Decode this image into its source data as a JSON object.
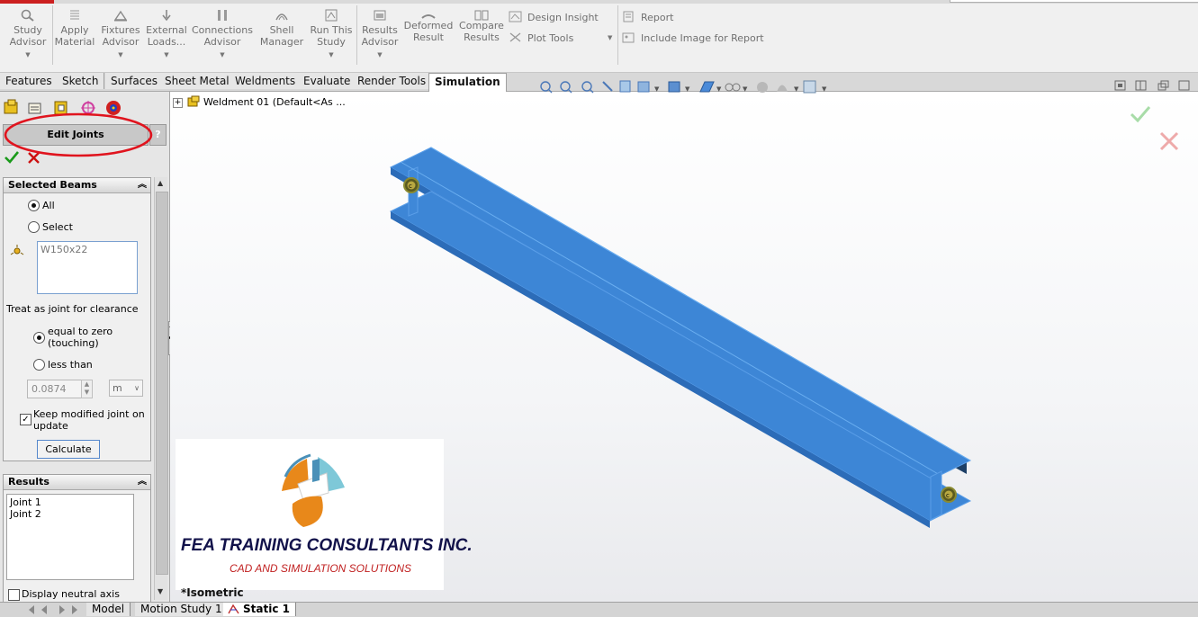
{
  "ribbon": {
    "buttons": [
      {
        "id": "study-advisor",
        "label": "Study Advisor",
        "icon": "study-advisor-icon",
        "dropdown": true
      },
      {
        "id": "apply-material",
        "label": "Apply Material",
        "icon": "material-icon",
        "dropdown": false
      },
      {
        "id": "fixtures-advisor",
        "label": "Fixtures Advisor",
        "icon": "fixture-icon",
        "dropdown": true
      },
      {
        "id": "external-loads",
        "label": "External Loads...",
        "icon": "loads-icon",
        "dropdown": true
      },
      {
        "id": "connections-advisor",
        "label": "Connections Advisor",
        "icon": "connections-icon",
        "dropdown": true
      },
      {
        "id": "shell-manager",
        "label": "Shell Manager",
        "icon": "shell-icon",
        "dropdown": false
      },
      {
        "id": "run-this-study",
        "label": "Run This Study",
        "icon": "run-icon",
        "dropdown": true
      },
      {
        "id": "results-advisor",
        "label": "Results Advisor",
        "icon": "results-icon",
        "dropdown": true
      },
      {
        "id": "deformed-result",
        "label": "Deformed Result",
        "icon": "deformed-icon",
        "dropdown": false
      },
      {
        "id": "compare-results",
        "label": "Compare Results",
        "icon": "compare-icon",
        "dropdown": false
      }
    ],
    "design_insight": "Design Insight",
    "plot_tools": "Plot Tools",
    "report": "Report",
    "include_image": "Include Image for Report"
  },
  "tabs": [
    "Features",
    "Sketch",
    "Surfaces",
    "Sheet Metal",
    "Weldments",
    "Evaluate",
    "Render Tools",
    "Simulation"
  ],
  "active_tab": "Simulation",
  "panel": {
    "title": "Edit Joints",
    "help": "?",
    "selected_beams": {
      "header": "Selected Beams",
      "opt_all": "All",
      "opt_select": "Select",
      "list": "W150x22",
      "treat_label": "Treat as joint for clearance",
      "opt_zero": "equal to zero (touching)",
      "opt_less": "less than",
      "value": "0.0874",
      "unit": "m",
      "keep_label": "Keep modified joint on update",
      "calculate": "Calculate"
    },
    "results": {
      "header": "Results",
      "items": [
        "Joint 1",
        "Joint 2"
      ],
      "neutral_axis": "Display neutral axis"
    }
  },
  "graphics": {
    "tree_item": "Weldment 01  (Default<As ...",
    "view_label": "*Isometric",
    "logo_title": "FEA TRAINING  CONSULTANTS  INC.",
    "logo_subtitle": "CAD AND SIMULATION SOLUTIONS",
    "joint_marker": "c",
    "colors": {
      "beam": "#3d86d6",
      "beam_dark": "#1b4a80",
      "annotation": "#e0141e"
    }
  },
  "status_tabs": [
    "Model",
    "Motion Study 1",
    "Static 1"
  ]
}
